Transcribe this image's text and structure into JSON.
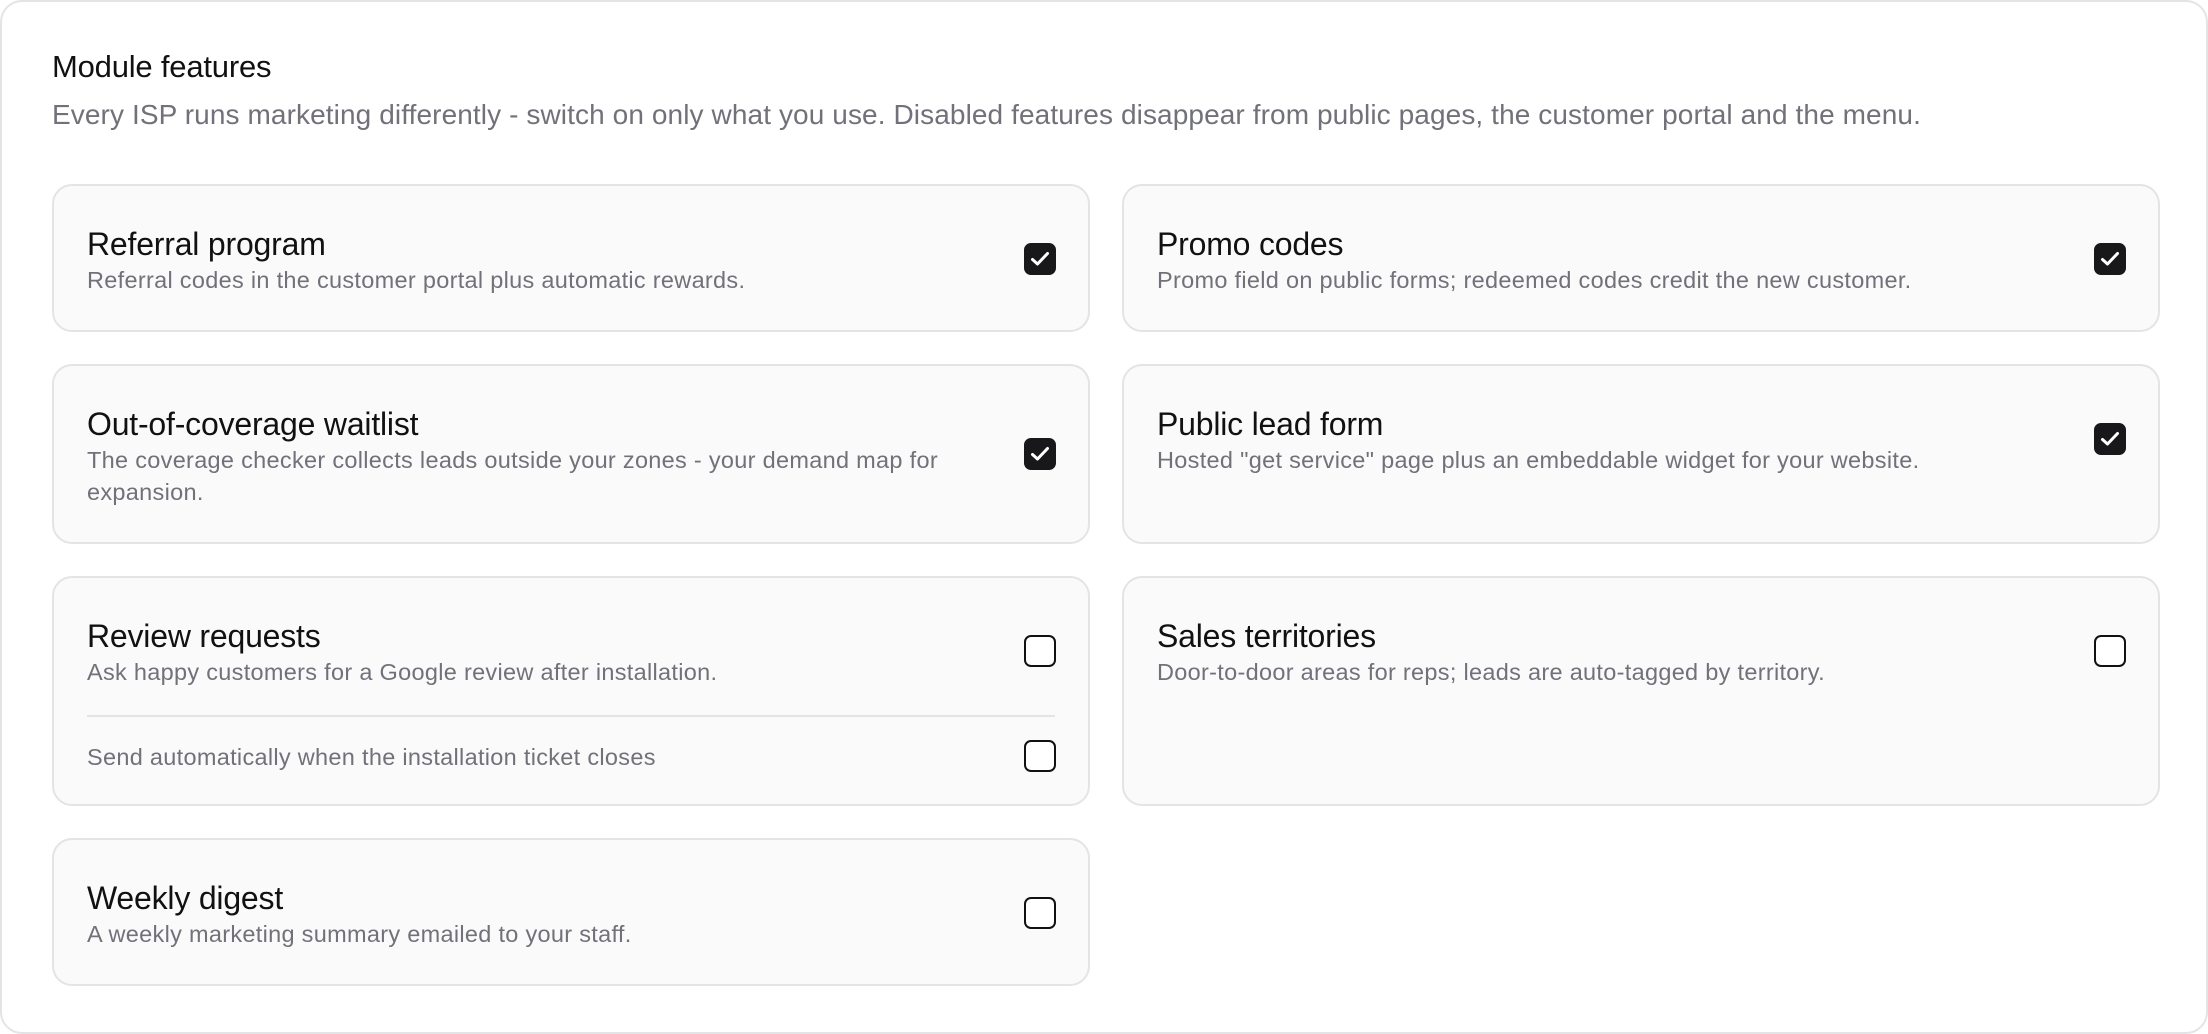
{
  "panel": {
    "title": "Module features",
    "description": "Every ISP runs marketing differently - switch on only what you use. Disabled features disappear from public pages, the customer portal and the menu."
  },
  "features": [
    {
      "title": "Referral program",
      "description": "Referral codes in the customer portal plus automatic rewards.",
      "enabled": true
    },
    {
      "title": "Promo codes",
      "description": "Promo field on public forms; redeemed codes credit the new customer.",
      "enabled": true
    },
    {
      "title": "Out-of-coverage waitlist",
      "description": "The coverage checker collects leads outside your zones - your demand map for expansion.",
      "enabled": true
    },
    {
      "title": "Public lead form",
      "description": "Hosted \"get service\" page plus an embeddable widget for your website.",
      "enabled": true
    },
    {
      "title": "Review requests",
      "description": "Ask happy customers for a Google review after installation.",
      "enabled": false,
      "sub_option": {
        "label": "Send automatically when the installation ticket closes",
        "enabled": false
      }
    },
    {
      "title": "Sales territories",
      "description": "Door-to-door areas for reps; leads are auto-tagged by territory.",
      "enabled": false
    },
    {
      "title": "Weekly digest",
      "description": "A weekly marketing summary emailed to your staff.",
      "enabled": false
    }
  ],
  "icons": {
    "checked": "check-icon"
  },
  "colors": {
    "checkbox_checked": "#18181b",
    "muted_text": "#71717a",
    "card_bg": "#fafafa",
    "border": "#e4e4e7"
  }
}
